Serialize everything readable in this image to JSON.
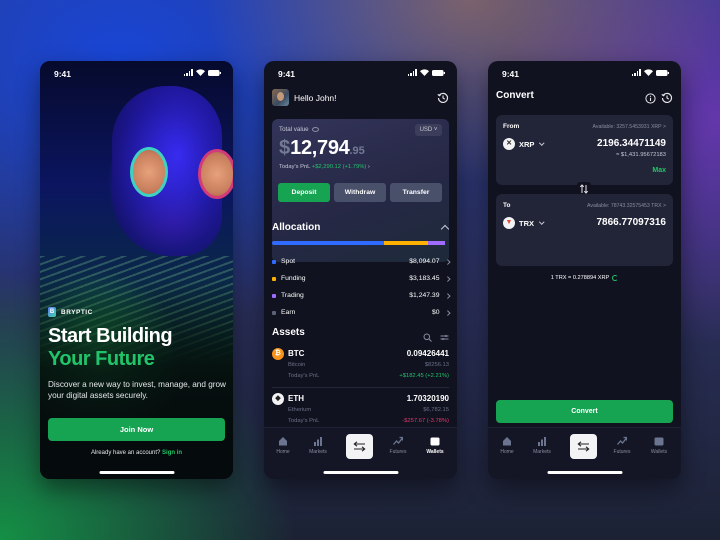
{
  "status_bar": {
    "time": "9:41"
  },
  "onboarding": {
    "brand": "BRYPTIC",
    "headline_line1": "Start Building",
    "headline_line2": "Your Future",
    "subtitle": "Discover a new way to invest, manage, and grow your digital assets securely.",
    "cta_label": "Join Now",
    "signin_prompt": "Already have an account?",
    "signin_link": "Sign in"
  },
  "wallet": {
    "greeting": "Hello John!",
    "total_label": "Total value",
    "currency": "USD",
    "balance_symbol": "$",
    "balance_int": "12,794",
    "balance_dec": ".95",
    "pnl_label": "Today's PnL",
    "pnl_value": "+$2,290.12 (+1.79%)",
    "actions": [
      "Deposit",
      "Withdraw",
      "Transfer"
    ],
    "allocation_title": "Allocation",
    "allocation": [
      {
        "label": "Spot",
        "value": "$8,094.07",
        "share": 0.633,
        "color": "#2f6bff"
      },
      {
        "label": "Funding",
        "value": "$3,183.45",
        "share": 0.249,
        "color": "#ffb000"
      },
      {
        "label": "Trading",
        "value": "$1,247.39",
        "share": 0.098,
        "color": "#a06bff"
      },
      {
        "label": "Earn",
        "value": "$0",
        "share": 0.0,
        "color": "#5b6278"
      }
    ],
    "assets_title": "Assets",
    "assets": [
      {
        "symbol": "BTC",
        "name": "Bitcoin",
        "amount": "0.09426441",
        "usd": "$8256.13",
        "pnl_label": "Today's PnL",
        "pnl": "+$182.45 (+2.21%)",
        "pnl_color": "#22c46a",
        "coin_color": "#f7931a",
        "coin_glyph": "₿"
      },
      {
        "symbol": "ETH",
        "name": "Etherium",
        "amount": "1.70320190",
        "usd": "$6,782.15",
        "pnl_label": "Today's PnL",
        "pnl": "-$257.67 (-3.78%)",
        "pnl_color": "#e23a6a",
        "coin_color": "#f3f3f5",
        "coin_glyph": "◆"
      }
    ]
  },
  "tabs": [
    "Home",
    "Markets",
    "Futures",
    "Wallets"
  ],
  "convert": {
    "title": "Convert",
    "from_label": "From",
    "from_available": "Available: 3257.5453931 XRP >",
    "from_token": "XRP",
    "from_amount": "2196.34471149",
    "from_usd": "≈ $1,431.95672183",
    "max_label": "Max",
    "to_label": "To",
    "to_available": "Available: 78743.32575453 TRX >",
    "to_token": "TRX",
    "to_amount": "7866.77097316",
    "rate": "1 TRX = 0.278894 XRP",
    "button_label": "Convert"
  }
}
